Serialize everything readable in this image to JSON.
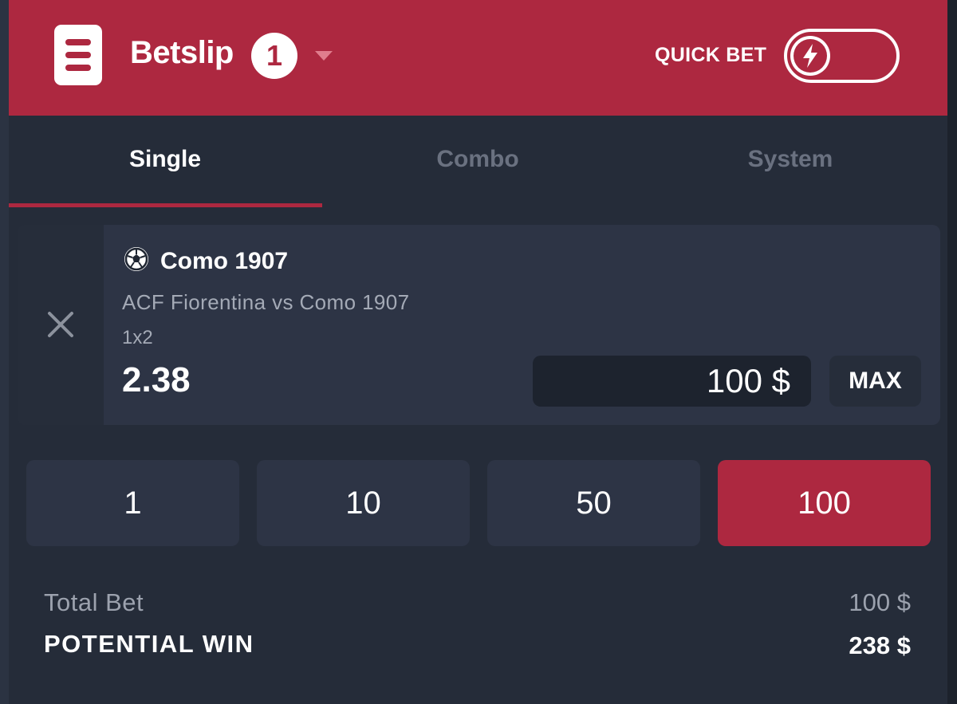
{
  "header": {
    "title": "Betslip",
    "count": "1",
    "quick_bet_label": "QUICK BET",
    "quick_bet_enabled": false,
    "accent_color": "#ad2840"
  },
  "tabs": [
    {
      "label": "Single",
      "active": true
    },
    {
      "label": "Combo",
      "active": false
    },
    {
      "label": "System",
      "active": false
    }
  ],
  "bet": {
    "sport_icon": "soccer-ball-icon",
    "selection": "Como 1907",
    "match": "ACF Fiorentina vs Como 1907",
    "market": "1x2",
    "odds": "2.38",
    "stake_value": "100 $",
    "max_label": "MAX"
  },
  "quick_stakes": [
    {
      "label": "1",
      "selected": false
    },
    {
      "label": "10",
      "selected": false
    },
    {
      "label": "50",
      "selected": false
    },
    {
      "label": "100",
      "selected": true
    }
  ],
  "summary": {
    "total_bet_label": "Total Bet",
    "total_bet_value": "100 $",
    "potential_win_label": "POTENTIAL WIN",
    "potential_win_value": "238 $"
  }
}
